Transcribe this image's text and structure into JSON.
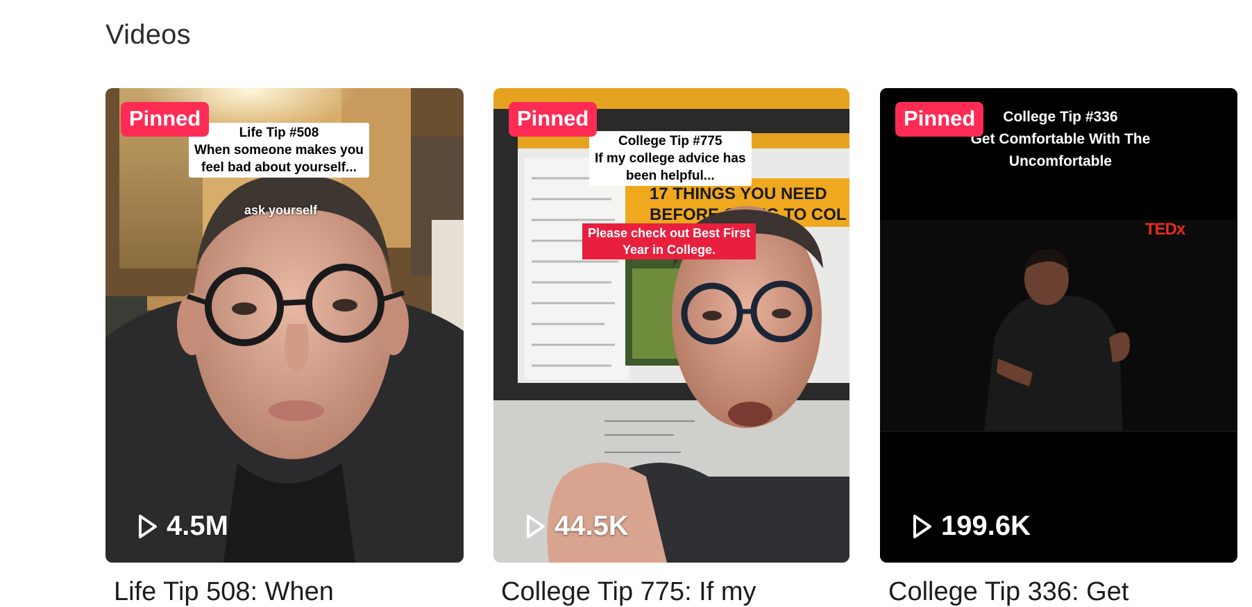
{
  "section": {
    "title": "Videos"
  },
  "videos": [
    {
      "badge": "Pinned",
      "views": "4.5M",
      "title": "Life Tip 508: When",
      "overlay_lines": [
        "Life Tip #508",
        "When someone makes you",
        "feel bad about yourself..."
      ],
      "overlay_small": "ask yourself"
    },
    {
      "badge": "Pinned",
      "views": "44.5K",
      "title": "College Tip 775: If my",
      "overlay_lines": [
        "College Tip #775",
        "If my college advice has",
        "been helpful..."
      ],
      "red_lines": [
        "Please check out Best First",
        "Year in College."
      ],
      "screen_heading": [
        "17 THINGS YOU NEED",
        "BEFORE GOING TO COL"
      ]
    },
    {
      "badge": "Pinned",
      "views": "199.6K",
      "title": "College Tip 336: Get",
      "overlay_lines": [
        "College Tip #336",
        "Get Comfortable With The",
        "Uncomfortable"
      ],
      "logo": "TEDx"
    }
  ],
  "colors": {
    "badge_bg": "#fe2c55",
    "title_text": "#1c1c1c",
    "heading_text": "#2c2c2c"
  },
  "icons": {
    "views": "play-icon"
  }
}
